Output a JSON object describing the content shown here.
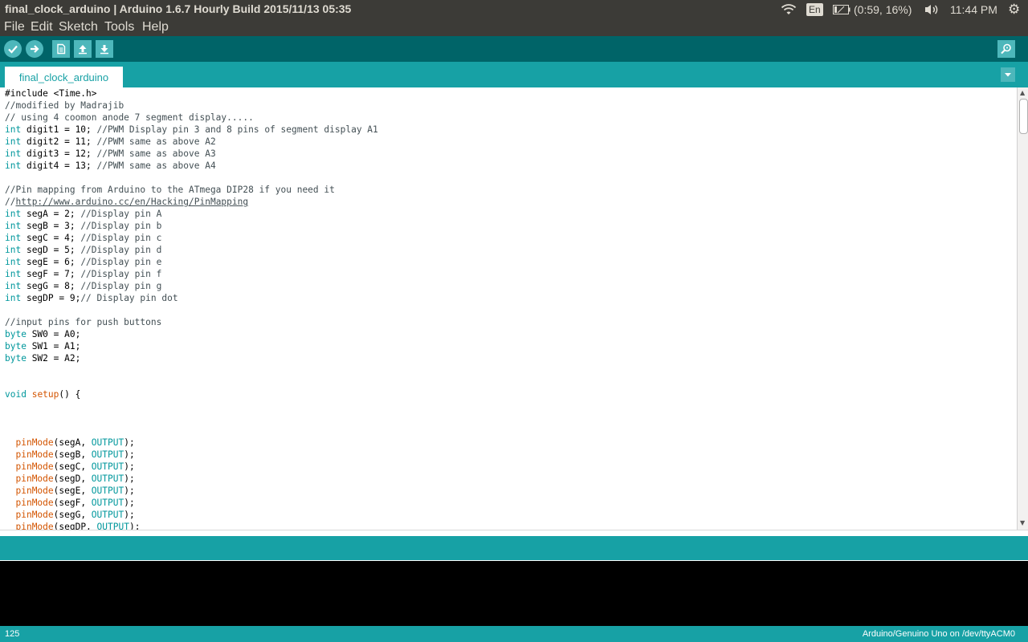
{
  "window": {
    "title": "final_clock_arduino | Arduino 1.6.7 Hourly Build 2015/11/13 05:35"
  },
  "system_tray": {
    "language": "En",
    "battery": "(0:59, 16%)",
    "time": "11:44 PM"
  },
  "menu": {
    "items": [
      "File",
      "Edit",
      "Sketch",
      "Tools",
      "Help"
    ]
  },
  "toolbar": {
    "buttons": [
      "verify-icon",
      "upload-icon",
      "new-icon",
      "open-icon",
      "save-icon"
    ],
    "serial_monitor": "serial-monitor-icon"
  },
  "tabs": {
    "active": "final_clock_arduino"
  },
  "editor": {
    "lines": [
      "#include <Time.h>",
      "//modified by Madrajib",
      "// using 4 coomon anode 7 segment display.....",
      "int digit1 = 10; //PWM Display pin 3 and 8 pins of segment display A1",
      "int digit2 = 11; //PWM same as above A2",
      "int digit3 = 12; //PWM same as above A3",
      "int digit4 = 13; //PWM same as above A4",
      "",
      "//Pin mapping from Arduino to the ATmega DIP28 if you need it",
      "//http://www.arduino.cc/en/Hacking/PinMapping",
      "int segA = 2; //Display pin A",
      "int segB = 3; //Display pin b",
      "int segC = 4; //Display pin c",
      "int segD = 5; //Display pin d",
      "int segE = 6; //Display pin e",
      "int segF = 7; //Display pin f",
      "int segG = 8; //Display pin g",
      "int segDP = 9;// Display pin dot",
      "",
      "//input pins for push buttons",
      "byte SW0 = A0;",
      "byte SW1 = A1;",
      "byte SW2 = A2;",
      "",
      "",
      "void setup() {",
      "",
      "",
      "",
      "  pinMode(segA, OUTPUT);",
      "  pinMode(segB, OUTPUT);",
      "  pinMode(segC, OUTPUT);",
      "  pinMode(segD, OUTPUT);",
      "  pinMode(segE, OUTPUT);",
      "  pinMode(segF, OUTPUT);",
      "  pinMode(segG, OUTPUT);",
      "  pinMode(segDP, OUTPUT);"
    ]
  },
  "status": {
    "line_number": "125",
    "board": "Arduino/Genuino Uno on /dev/ttyACM0"
  },
  "colors": {
    "toolbar": "#006468",
    "tabbar": "#17a1a5",
    "keyword": "#00979c",
    "function": "#d35400"
  }
}
